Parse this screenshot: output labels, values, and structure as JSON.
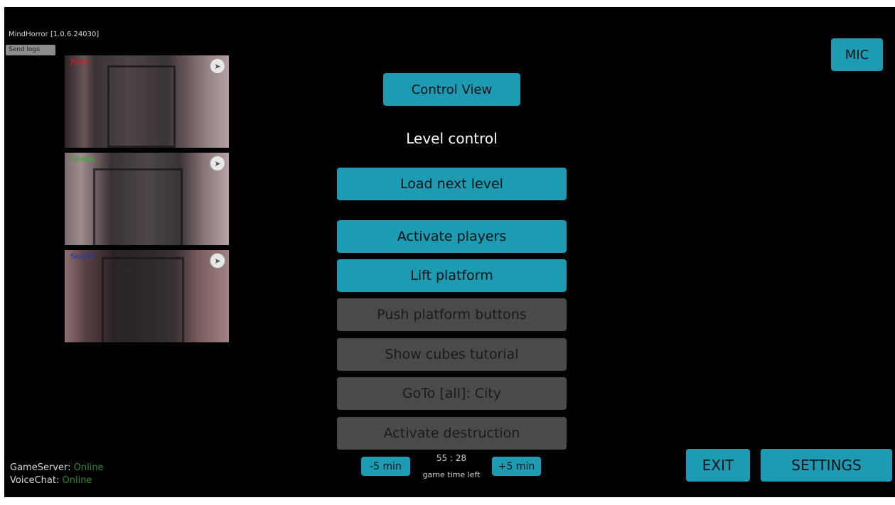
{
  "app": {
    "version_label": "MindHorror [1.0.6.24030]",
    "send_logs_label": "Send logs"
  },
  "cameras": [
    {
      "player": "Jonn",
      "player_color": "#c0202a",
      "icon": "navigation-arrow-icon"
    },
    {
      "player": "Gregn",
      "player_color": "#3aa63a",
      "icon": "navigation-arrow-icon"
    },
    {
      "player": "Scotti",
      "player_color": "#2a3aa8",
      "icon": "navigation-arrow-icon"
    }
  ],
  "controls": {
    "control_view_label": "Control View",
    "section_title": "Level control",
    "load_next_level_label": "Load next level",
    "activate_players_label": "Activate players",
    "lift_platform_label": "Lift platform",
    "push_platform_buttons_label": "Push platform buttons",
    "show_cubes_tutorial_label": "Show cubes tutorial",
    "goto_city_label": "GoTo [all]: City",
    "activate_destruction_label": "Activate destruction"
  },
  "timer": {
    "minus_label": "-5 min",
    "plus_label": "+5 min",
    "time_value": "55 : 28",
    "caption": "game time left"
  },
  "status": {
    "game_server_label": "GameServer:",
    "game_server_value": "Online",
    "voice_chat_label": "VoiceChat:",
    "voice_chat_value": "Online"
  },
  "top_right": {
    "mic_label": "MIC"
  },
  "bottom_right": {
    "exit_label": "EXIT",
    "settings_label": "SETTINGS"
  },
  "colors": {
    "accent": "#1c9bb3",
    "disabled": "#4a4a4a",
    "online": "#2e8a2e",
    "background": "#000000"
  }
}
